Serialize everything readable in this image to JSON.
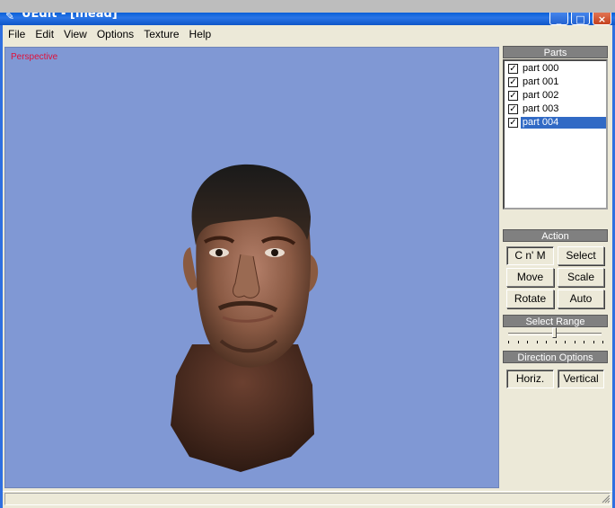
{
  "window": {
    "title": "UEdit - [Ihead]"
  },
  "menubar": {
    "items": [
      "File",
      "Edit",
      "View",
      "Options",
      "Texture",
      "Help"
    ]
  },
  "viewport": {
    "label": "Perspective"
  },
  "parts_panel": {
    "header": "Parts",
    "items": [
      {
        "label": "part 000",
        "checked": true,
        "selected": false
      },
      {
        "label": "part 001",
        "checked": true,
        "selected": false
      },
      {
        "label": "part 002",
        "checked": true,
        "selected": false
      },
      {
        "label": "part 003",
        "checked": true,
        "selected": false
      },
      {
        "label": "part 004",
        "checked": true,
        "selected": true
      }
    ]
  },
  "action_panel": {
    "header": "Action",
    "buttons": {
      "cnm": "C n' M",
      "select": "Select",
      "move": "Move",
      "scale": "Scale",
      "rotate": "Rotate",
      "auto": "Auto"
    },
    "pressed": "cnm"
  },
  "select_range": {
    "header": "Select Range",
    "slider_value": 0.55
  },
  "direction_options": {
    "header": "Direction Options",
    "horizontal_label": "Horiz.",
    "vertical_label": "Vertical"
  },
  "colors": {
    "viewport_bg": "#8098d4",
    "viewport_label": "#e0103a",
    "selection": "#316ac5",
    "panel_header": "#808080"
  }
}
